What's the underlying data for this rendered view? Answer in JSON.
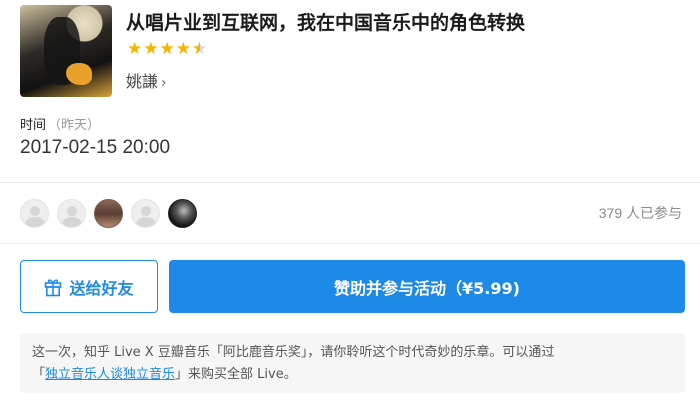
{
  "live": {
    "title": "从唱片业到互联网，我在中国音乐中的角色转换",
    "rating": 4.5,
    "speaker": "姚謙",
    "speaker_chevron": "›"
  },
  "time": {
    "label": "时间",
    "note": "（昨天）",
    "value": "2017-02-15 20:00"
  },
  "participants": {
    "count_text": "379 人已参与",
    "avatars": [
      "default-avatar",
      "default-avatar",
      "photo-avatar",
      "default-avatar",
      "photo-avatar"
    ]
  },
  "actions": {
    "gift_label": "送给好友",
    "sponsor_label": "赞助并参与活动（¥5.99)"
  },
  "info": {
    "text_before": "这一次，知乎 Live X 豆瓣音乐「阿比鹿音乐奖」，请你聆听这个时代奇妙的乐章。可以通过",
    "open_quote": "「",
    "link_text": "独立音乐人谈独立音乐",
    "text_after": "」来购买全部 Live。"
  },
  "colors": {
    "accent": "#1e8ae8",
    "star": "#f4b400",
    "muted_text": "#8a8a8a",
    "info_bg": "#f6f6f6"
  }
}
